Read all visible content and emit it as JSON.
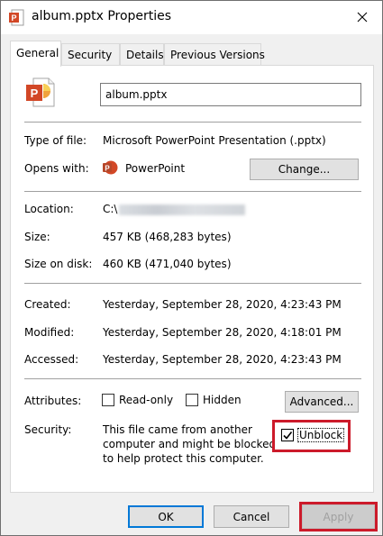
{
  "window": {
    "title": "album.pptx Properties"
  },
  "tabs": [
    {
      "label": "General",
      "active": true
    },
    {
      "label": "Security",
      "active": false
    },
    {
      "label": "Details",
      "active": false
    },
    {
      "label": "Previous Versions",
      "active": false
    }
  ],
  "general": {
    "filename": "album.pptx",
    "type_label": "Type of file:",
    "type_value": "Microsoft PowerPoint Presentation (.pptx)",
    "opens_label": "Opens with:",
    "opens_value": "PowerPoint",
    "change_button": "Change...",
    "location_label": "Location:",
    "location_value": "C:\\",
    "size_label": "Size:",
    "size_value": "457 KB (468,283 bytes)",
    "size_disk_label": "Size on disk:",
    "size_disk_value": "460 KB (471,040 bytes)",
    "created_label": "Created:",
    "created_value": "Yesterday, September 28, 2020, 4:23:43 PM",
    "modified_label": "Modified:",
    "modified_value": "Yesterday, September 28, 2020, 4:18:01 PM",
    "accessed_label": "Accessed:",
    "accessed_value": "Yesterday, September 28, 2020, 4:23:43 PM",
    "attributes_label": "Attributes:",
    "readonly_label": "Read-only",
    "hidden_label": "Hidden",
    "advanced_button": "Advanced...",
    "security_label": "Security:",
    "security_text": "This file came from another computer and might be blocked to help protect this computer.",
    "unblock_label": "Unblock",
    "unblock_checked": true,
    "readonly_checked": false,
    "hidden_checked": false
  },
  "footer": {
    "ok": "OK",
    "cancel": "Cancel",
    "apply": "Apply"
  },
  "colors": {
    "highlight": "#cc1a2a",
    "ppt_orange": "#d24726",
    "focus_blue": "#0078d7"
  }
}
